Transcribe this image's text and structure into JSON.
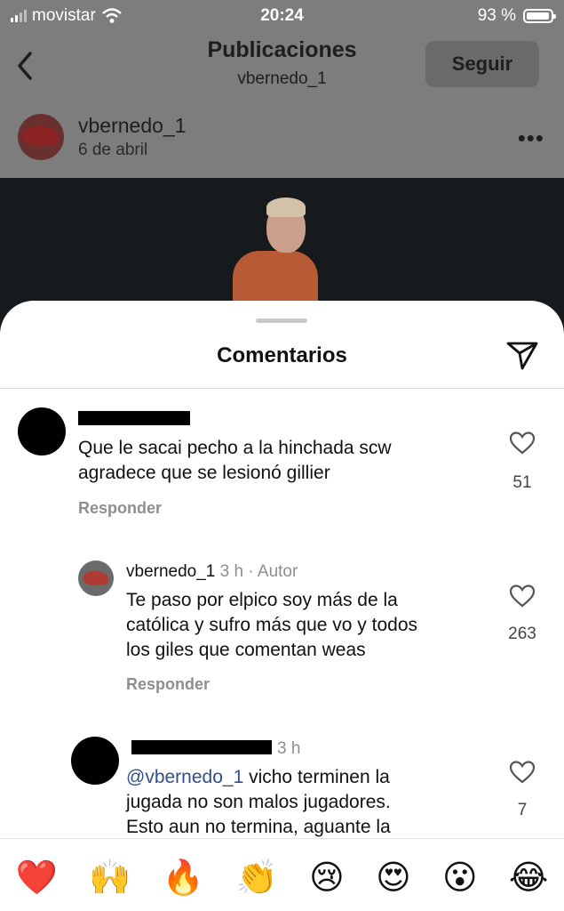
{
  "status_bar": {
    "carrier": "movistar",
    "time": "20:24",
    "battery": "93 %"
  },
  "nav": {
    "title": "Publicaciones",
    "subtitle": "vbernedo_1",
    "follow_label": "Seguir"
  },
  "post": {
    "username": "vbernedo_1",
    "date": "6 de abril"
  },
  "sheet": {
    "title": "Comentarios"
  },
  "comments": [
    {
      "text_line1": "Que le sacai pecho a la hinchada scw",
      "text_line2": "agradece que se lesionó gillier",
      "reply_label": "Responder",
      "likes": "51"
    },
    {
      "username": "vbernedo_1",
      "time": "3 h · Autor",
      "text_line1": "Te paso por elpico soy más de la",
      "text_line2": "católica y sufro más que vo y todos",
      "text_line3": "los giles que comentan weas",
      "reply_label": "Responder",
      "likes": "263"
    },
    {
      "time": "3 h",
      "mention": "@vbernedo_1",
      "text_line1_rest": " vicho terminen la",
      "text_line2": "jugada no son malos jugadores.",
      "text_line3": "Esto aun no termina, aguante la",
      "likes": "7"
    }
  ],
  "emoji_bar": [
    "❤️",
    "🙌",
    "🔥",
    "👏",
    "😢",
    "😍",
    "😮",
    "😂"
  ]
}
